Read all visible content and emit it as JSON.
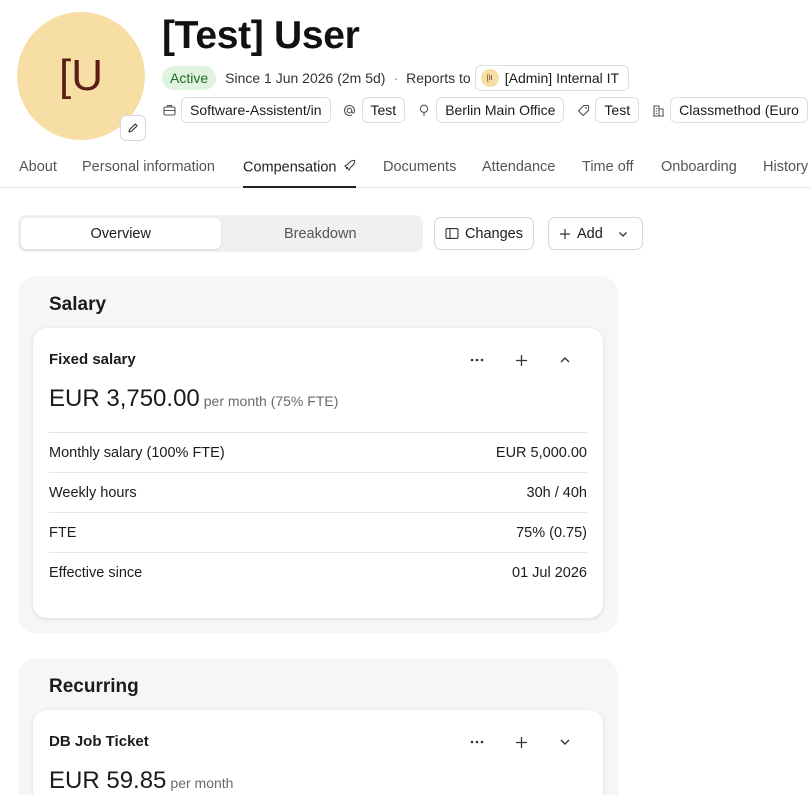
{
  "profile": {
    "avatar_initials": "[U",
    "name": "[Test] User",
    "status": "Active",
    "since": "Since 1 Jun 2026 (2m 5d)",
    "separator": "·",
    "reports_to_label": "Reports to",
    "manager_initials": "[II",
    "manager_name": "[Admin] Internal IT",
    "tags": [
      {
        "icon": "briefcase-icon",
        "label": "Software-Assistent/in"
      },
      {
        "icon": "at-sign-icon",
        "label": "Test"
      },
      {
        "icon": "location-pin-icon",
        "label": "Berlin Main Office"
      },
      {
        "icon": "tag-icon",
        "label": "Test"
      },
      {
        "icon": "building-icon",
        "label": "Classmethod (Euro"
      }
    ]
  },
  "tabs": [
    {
      "label": "About"
    },
    {
      "label": "Personal information"
    },
    {
      "label": "Compensation",
      "active": true
    },
    {
      "label": "Documents"
    },
    {
      "label": "Attendance"
    },
    {
      "label": "Time off"
    },
    {
      "label": "Onboarding"
    },
    {
      "label": "History"
    }
  ],
  "toolbar": {
    "segments": [
      "Overview",
      "Breakdown"
    ],
    "changes_label": "Changes",
    "add_label": "Add"
  },
  "salary": {
    "section_title": "Salary",
    "card_title": "Fixed salary",
    "amount": "EUR 3,750.00",
    "amount_suffix": "per month (75% FTE)",
    "rows": [
      {
        "label": "Monthly salary (100% FTE)",
        "value": "EUR 5,000.00"
      },
      {
        "label": "Weekly hours",
        "value": "30h / 40h"
      },
      {
        "label": "FTE",
        "value": "75% (0.75)"
      },
      {
        "label": "Effective since",
        "value": "01 Jul 2026"
      }
    ]
  },
  "recurring": {
    "section_title": "Recurring",
    "card_title": "DB Job Ticket",
    "amount": "EUR 59.85",
    "amount_suffix": "per month"
  },
  "colors": {
    "avatar_bg": "#f7dea5",
    "avatar_text": "#5a1f12",
    "active_badge_bg": "#dff3df",
    "active_badge_text": "#1f6b2c"
  }
}
